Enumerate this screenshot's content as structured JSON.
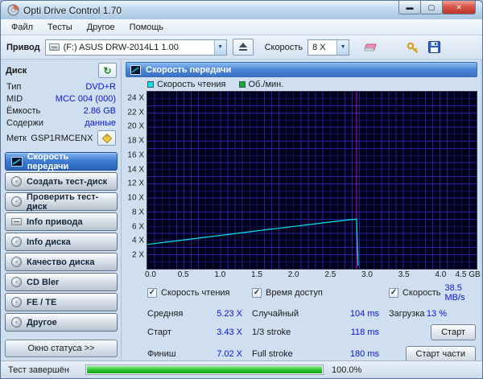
{
  "window": {
    "title": "Opti Drive Control 1.70"
  },
  "menu": {
    "items": [
      "Файл",
      "Тесты",
      "Другое",
      "Помощь"
    ]
  },
  "toolbar": {
    "drive_label": "Привод",
    "drive_value": "(F:)  ASUS DRW-2014L1 1.00",
    "speed_label": "Скорость",
    "speed_value": "8 X"
  },
  "sidebar": {
    "disk_header": "Диск",
    "info": [
      {
        "label": "Тип",
        "value": "DVD+R"
      },
      {
        "label": "MID",
        "value": "MCC 004 (000)"
      },
      {
        "label": "Ёмкость",
        "value": "2.86 GB"
      },
      {
        "label": "Содержи",
        "value": "данные"
      }
    ],
    "label_row": {
      "label": "Метк",
      "value": "GSP1RMCENX"
    },
    "buttons": [
      {
        "label": "Скорость передачи",
        "selected": true
      },
      {
        "label": "Создать тест-диск",
        "selected": false
      },
      {
        "label": "Проверить тест-диск",
        "selected": false
      },
      {
        "label": "Info привода",
        "selected": false
      },
      {
        "label": "Info диска",
        "selected": false
      },
      {
        "label": "Качество диска",
        "selected": false
      },
      {
        "label": "CD Bler",
        "selected": false
      },
      {
        "label": "FE / TE",
        "selected": false
      },
      {
        "label": "Другое",
        "selected": false
      }
    ],
    "status_button": "Окно статуса >>"
  },
  "main": {
    "header": "Скорость передачи",
    "legend": [
      {
        "label": "Скорость чтения",
        "color": "#00e8e8"
      },
      {
        "label": "Об./мин.",
        "color": "#0faf2a"
      }
    ],
    "checkboxes": [
      {
        "label": "Скорость чтения",
        "checked": true
      },
      {
        "label": "Время доступ",
        "checked": true
      },
      {
        "label": "Скорость",
        "checked": true
      }
    ],
    "speed_readout": "38.5 MB/s",
    "stats": {
      "col1": [
        {
          "label": "Средняя",
          "value": "5.23 X"
        },
        {
          "label": "Старт",
          "value": "3.43 X"
        },
        {
          "label": "Финиш",
          "value": "7.02 X"
        }
      ],
      "col2": [
        {
          "label": "Случайный",
          "value": "104 ms"
        },
        {
          "label": "1/3 stroke",
          "value": "118 ms"
        },
        {
          "label": "Full stroke",
          "value": "180 ms"
        }
      ],
      "load": {
        "label": "Загрузка",
        "value": "13 %"
      }
    },
    "buttons": {
      "start": "Старт",
      "start_parts": "Старт части"
    }
  },
  "statusbar": {
    "text": "Тест завершён",
    "percent_label": "100.0%",
    "progress_percent": 100
  },
  "chart_data": {
    "type": "line",
    "title": "Скорость передачи",
    "xlabel": "GB",
    "ylabel": "X",
    "xlim": [
      0,
      4.5
    ],
    "ylim": [
      0,
      25
    ],
    "bg": "#00001a",
    "grid": {
      "x_step": 0.1,
      "y_step": 1,
      "color": "#2626b0"
    },
    "marker_x": 2.86,
    "marker_color": "#b400b4",
    "x_ticks": [
      {
        "v": 0.0,
        "label": "0.0"
      },
      {
        "v": 0.5,
        "label": "0.5"
      },
      {
        "v": 1.0,
        "label": "1.0"
      },
      {
        "v": 1.5,
        "label": "1.5"
      },
      {
        "v": 2.0,
        "label": "2.0"
      },
      {
        "v": 2.5,
        "label": "2.5"
      },
      {
        "v": 3.0,
        "label": "3.0"
      },
      {
        "v": 3.5,
        "label": "3.5"
      },
      {
        "v": 4.0,
        "label": "4.0"
      },
      {
        "v": 4.5,
        "label": "4.5 GB"
      }
    ],
    "y_ticks": [
      {
        "v": 24,
        "label": "24 X"
      },
      {
        "v": 22,
        "label": "22 X"
      },
      {
        "v": 20,
        "label": "20 X"
      },
      {
        "v": 18,
        "label": "18 X"
      },
      {
        "v": 16,
        "label": "16 X"
      },
      {
        "v": 14,
        "label": "14 X"
      },
      {
        "v": 12,
        "label": "12 X"
      },
      {
        "v": 10,
        "label": "10 X"
      },
      {
        "v": 8,
        "label": "8 X"
      },
      {
        "v": 6,
        "label": "6 X"
      },
      {
        "v": 4,
        "label": "4 X"
      },
      {
        "v": 2,
        "label": "2 X"
      }
    ],
    "series": [
      {
        "name": "Скорость чтения",
        "color": "#00e8e8",
        "points": [
          [
            0,
            3.43
          ],
          [
            0.3,
            3.82
          ],
          [
            0.6,
            4.2
          ],
          [
            0.9,
            4.58
          ],
          [
            1.2,
            4.97
          ],
          [
            1.5,
            5.35
          ],
          [
            1.8,
            5.73
          ],
          [
            2.1,
            6.1
          ],
          [
            2.4,
            6.48
          ],
          [
            2.7,
            6.85
          ],
          [
            2.86,
            7.02
          ],
          [
            2.88,
            0.4
          ]
        ]
      },
      {
        "name": "Об./мин.",
        "color": "#0faf2a",
        "points": []
      }
    ]
  }
}
